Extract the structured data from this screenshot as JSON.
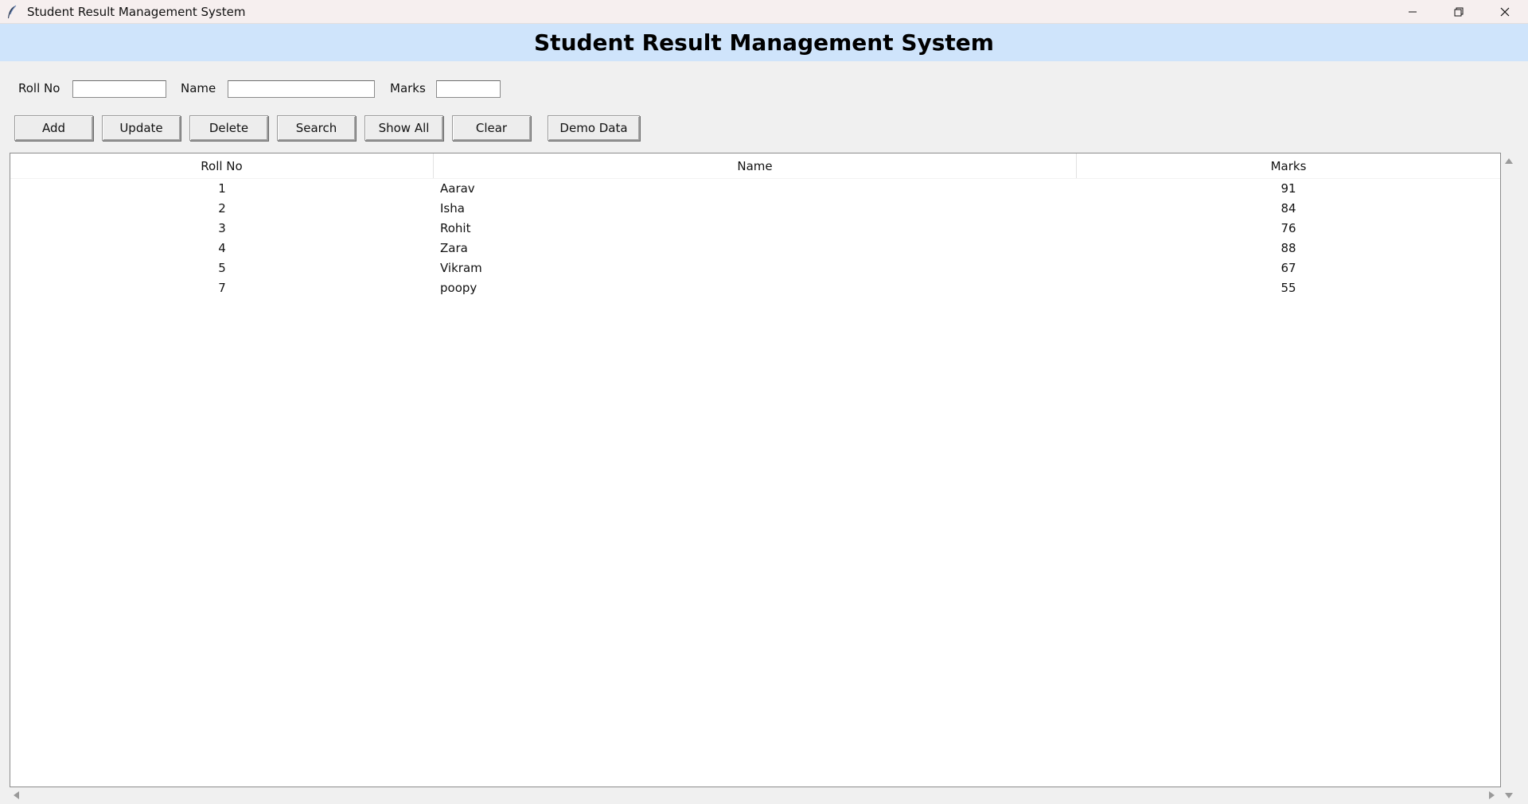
{
  "window": {
    "title": "Student Result Management System"
  },
  "header": {
    "title": "Student Result Management System",
    "background": "#cfe4fb"
  },
  "form": {
    "roll_label": "Roll No",
    "roll_value": "",
    "name_label": "Name",
    "name_value": "",
    "marks_label": "Marks",
    "marks_value": ""
  },
  "buttons": {
    "add": "Add",
    "update": "Update",
    "delete": "Delete",
    "search": "Search",
    "show_all": "Show All",
    "clear": "Clear",
    "demo_data": "Demo Data"
  },
  "table": {
    "columns": [
      "Roll No",
      "Name",
      "Marks"
    ],
    "rows": [
      {
        "roll": "1",
        "name": "Aarav",
        "marks": "91"
      },
      {
        "roll": "2",
        "name": "Isha",
        "marks": "84"
      },
      {
        "roll": "3",
        "name": "Rohit",
        "marks": "76"
      },
      {
        "roll": "4",
        "name": "Zara",
        "marks": "88"
      },
      {
        "roll": "5",
        "name": "Vikram",
        "marks": "67"
      },
      {
        "roll": "7",
        "name": "poopy",
        "marks": "55"
      }
    ]
  },
  "icons": {
    "app": "feather-icon",
    "minimize": "minimize-icon",
    "maximize": "restore-icon",
    "close": "close-icon"
  }
}
